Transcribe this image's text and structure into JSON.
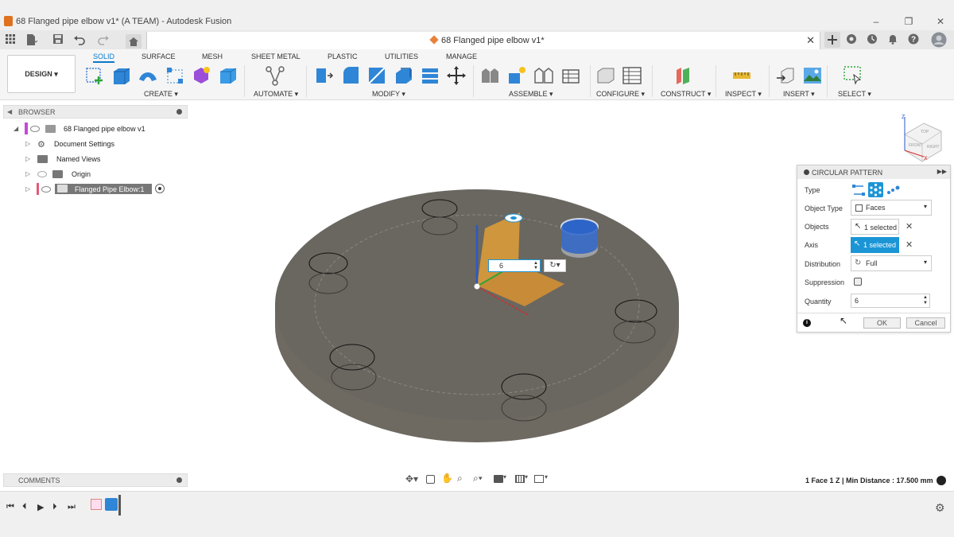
{
  "window": {
    "title": "68 Flanged pipe elbow v1* (A TEAM) - Autodesk Fusion",
    "minimize": "–",
    "maximize": "❐",
    "close": "✕"
  },
  "document_tab": {
    "title": "68 Flanged pipe elbow v1*",
    "close": "✕"
  },
  "workspace": {
    "label": "DESIGN ▾"
  },
  "ribbon": {
    "tabs": [
      "SOLID",
      "SURFACE",
      "MESH",
      "SHEET METAL",
      "PLASTIC",
      "UTILITIES",
      "MANAGE"
    ],
    "active_tab": "SOLID",
    "groups": [
      "CREATE ▾",
      "AUTOMATE ▾",
      "MODIFY ▾",
      "ASSEMBLE ▾",
      "CONFIGURE ▾",
      "CONSTRUCT ▾",
      "INSPECT ▾",
      "INSERT ▾",
      "SELECT ▾"
    ]
  },
  "browser": {
    "header": "BROWSER",
    "items": [
      {
        "label": "68 Flanged pipe elbow v1"
      },
      {
        "label": "Document Settings"
      },
      {
        "label": "Named Views"
      },
      {
        "label": "Origin"
      },
      {
        "label": "Flanged Pipe Elbow:1"
      }
    ]
  },
  "viewcube": {
    "face_top": "TOP",
    "face_front": "FRONT",
    "face_right": "RIGHT",
    "axis_z": "Z",
    "axis_x": "X"
  },
  "quantity_input": {
    "value": "6"
  },
  "circular_pattern": {
    "title": "CIRCULAR PATTERN",
    "rows": {
      "type_label": "Type",
      "object_type_label": "Object Type",
      "object_type_value": "Faces",
      "objects_label": "Objects",
      "objects_value": "1 selected",
      "axis_label": "Axis",
      "axis_value": "1 selected",
      "distribution_label": "Distribution",
      "distribution_value": "Full",
      "suppression_label": "Suppression",
      "quantity_label": "Quantity",
      "quantity_value": "6"
    },
    "ok": "OK",
    "cancel": "Cancel"
  },
  "comments": {
    "header": "COMMENTS"
  },
  "status": {
    "text": "1 Face 1 Z | Min Distance : 17.500 mm"
  },
  "colors": {
    "accent": "#0a7acc",
    "selection": "#1b95d6",
    "flange": "#6a6860",
    "preview": "#f2a531"
  }
}
